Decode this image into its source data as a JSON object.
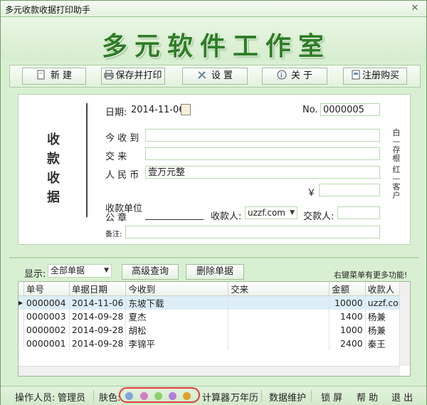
{
  "window": {
    "title": "多元收款收据打印助手"
  },
  "banner": {
    "title": "多元软件工作室"
  },
  "toolbar": {
    "new": "新 建",
    "save_print": "保存并打印",
    "settings": "设 置",
    "about": "关 于",
    "register": "注册购买"
  },
  "receipt": {
    "heading": "收款收据",
    "date_label": "日期:",
    "date_value": "2014-11-06",
    "no_label": "No.",
    "no_value": "0000005",
    "receive_from_label": "今 收 到",
    "pay_for_label": "交    来",
    "rmb_label": "人 民 币",
    "rmb_value": "壹万元整",
    "yen_symbol": "￥",
    "unit_label_1": "收款单位",
    "unit_label_2": "公    章",
    "payee_label": "收款人:",
    "payee_value": "uzzf.com",
    "payer_label": "交款人:",
    "remark_label": "备注:",
    "side_white": "白—存根",
    "side_red": "红—客户"
  },
  "filter": {
    "display_label": "显示:",
    "display_value": "全部单据",
    "advanced_query": "高级查询",
    "delete_doc": "删除单据",
    "right_click_hint": "右键菜单有更多功能!"
  },
  "table": {
    "columns": [
      "单号",
      "单据日期",
      "今收到",
      "交来",
      "金额",
      "收款人"
    ],
    "rows": [
      [
        "0000004",
        "2014-11-06",
        "东坡下载",
        "",
        "10000",
        "uzzf.com"
      ],
      [
        "0000003",
        "2014-09-28",
        "夏杰",
        "",
        "1400",
        "杨兼"
      ],
      [
        "0000002",
        "2014-09-28",
        "胡松",
        "",
        "1000",
        "杨兼"
      ],
      [
        "0000001",
        "2014-09-28",
        "李锦平",
        "",
        "2400",
        "秦王"
      ]
    ]
  },
  "statusbar": {
    "operator_label": "操作人员:",
    "operator_value": "管理员",
    "skin_label": "肤色:",
    "skin_colors": [
      "#7fa6d6",
      "#d07fc0",
      "#8ccf6e",
      "#b07fd8",
      "#e0a02a"
    ],
    "calculator": "计算器",
    "calendar": "万年历",
    "data_maintain": "数据维护",
    "lock": "锁 屏",
    "help": "帮 助",
    "exit": "退 出"
  }
}
